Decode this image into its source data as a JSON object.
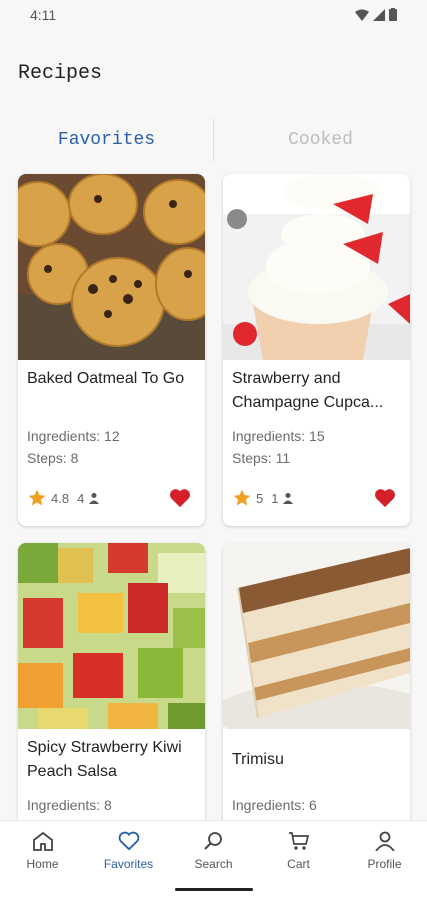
{
  "status": {
    "time": "4:11"
  },
  "page": {
    "title": "Recipes"
  },
  "tabs": [
    {
      "label": "Favorites",
      "active": true
    },
    {
      "label": "Cooked",
      "active": false
    }
  ],
  "recipes": [
    {
      "title": "Baked Oatmeal To Go",
      "ingredients": "Ingredients: 12",
      "steps": "Steps: 8",
      "rating": "4.8",
      "count": "4",
      "favorited": true
    },
    {
      "title": "Strawberry and Champagne Cupca...",
      "ingredients": "Ingredients: 15",
      "steps": "Steps: 11",
      "rating": "5",
      "count": "1",
      "favorited": true
    },
    {
      "title": "Spicy Strawberry Kiwi Peach Salsa",
      "ingredients": "Ingredients: 8",
      "steps": "",
      "rating": "",
      "count": "",
      "favorited": true
    },
    {
      "title": "Trimisu",
      "ingredients": "Ingredients: 6",
      "steps": "",
      "rating": "",
      "count": "",
      "favorited": true
    }
  ],
  "nav": {
    "items": [
      {
        "label": "Home",
        "icon": "home-icon"
      },
      {
        "label": "Favorites",
        "icon": "heart-icon",
        "active": true
      },
      {
        "label": "Search",
        "icon": "search-icon"
      },
      {
        "label": "Cart",
        "icon": "cart-icon"
      },
      {
        "label": "Profile",
        "icon": "profile-icon"
      }
    ]
  },
  "colors": {
    "accent": "#2a5fa8",
    "heart": "#d5202a",
    "star": "#f0a020"
  }
}
